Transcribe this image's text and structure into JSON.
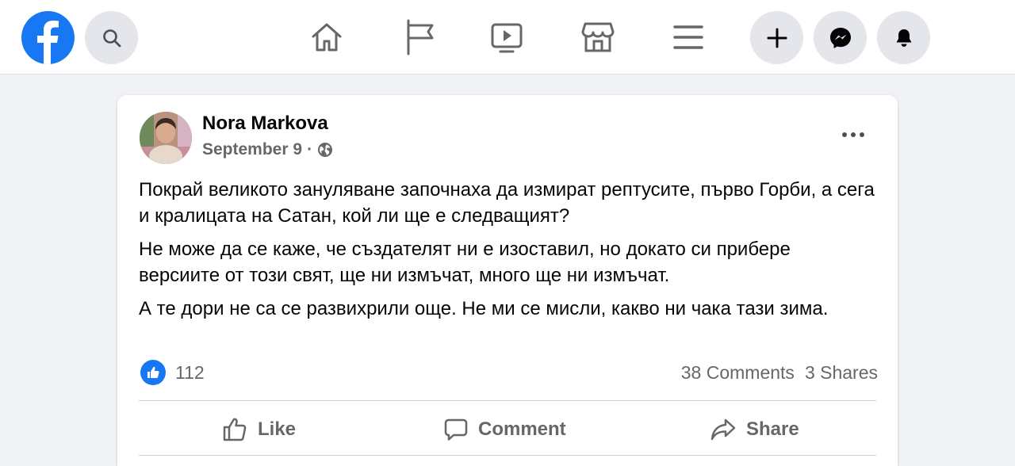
{
  "colors": {
    "brand": "#1877f2",
    "nav_icon": "#65676b",
    "text_primary": "#050505",
    "text_secondary": "#65676b",
    "page_bg": "#f0f2f5"
  },
  "topbar": {
    "logo_icon": "facebook-logo",
    "search_icon": "search-icon",
    "nav_icons": [
      "home-icon",
      "pages-flag-icon",
      "watch-video-icon",
      "marketplace-icon",
      "menu-icon"
    ],
    "right_icons": [
      "create-plus-icon",
      "messenger-icon",
      "notifications-bell-icon"
    ]
  },
  "post": {
    "author": "Nora Markova",
    "date": "September 9",
    "separator": "·",
    "privacy_icon": "globe-icon",
    "paragraphs": [
      "Покрай великото зануляване започнаха да измират рептусите, първо Горби, а сега и кралицата на Сатан, кой ли ще е следващият?",
      "Не може да се каже, че създателят ни е изоставил, но докато си прибере версиите от този свят, ще ни измъчат, много ще ни измъчат.",
      "А те дори не са се развихрили още. Не ми се мисли, какво ни чака тази зима."
    ],
    "reactions": {
      "icon": "like-reaction-icon",
      "count": "112"
    },
    "comments_label": "38 Comments",
    "shares_label": "3 Shares",
    "actions": {
      "like": "Like",
      "comment": "Comment",
      "share": "Share"
    }
  }
}
